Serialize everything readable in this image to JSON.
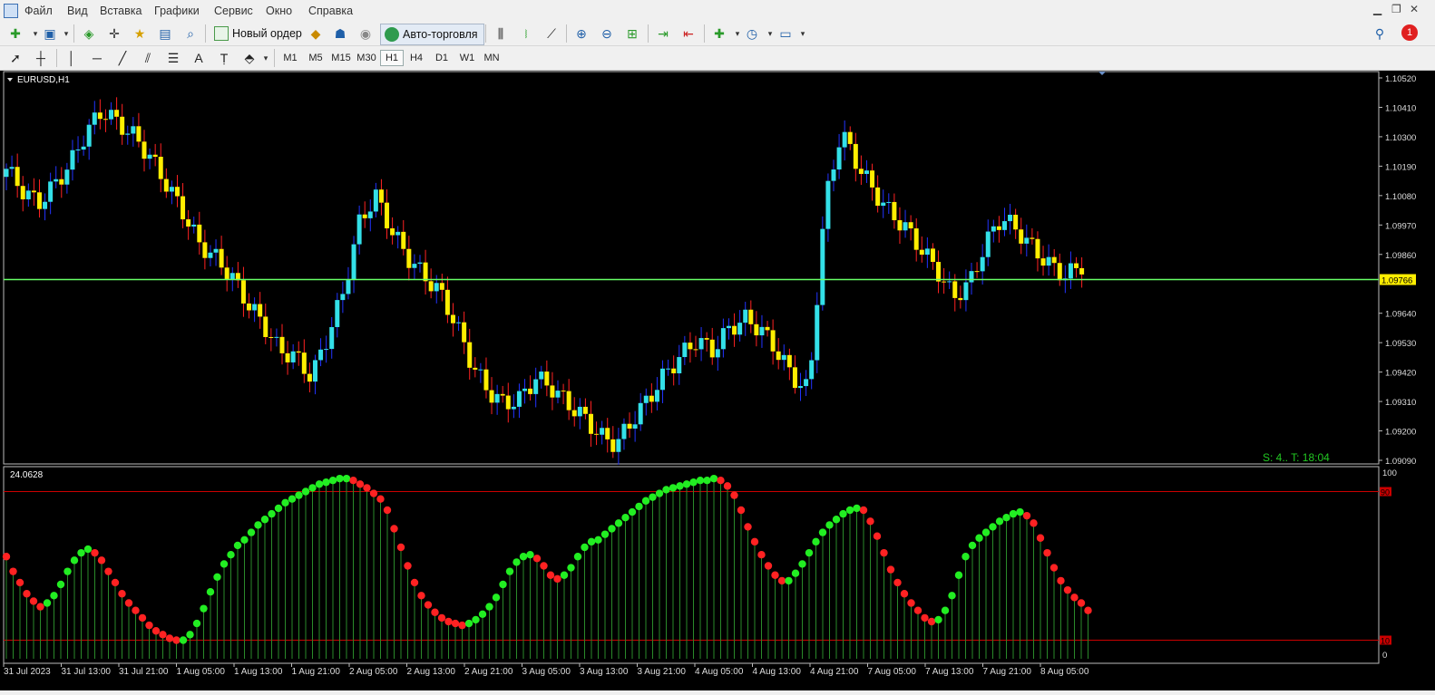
{
  "menu": [
    "Файл",
    "Вид",
    "Вставка",
    "Графики",
    "Сервис",
    "Окно",
    "Справка"
  ],
  "toolbar": {
    "new_order": "Новый ордер",
    "auto_trading": "Авто-торговля",
    "notification_count": "1"
  },
  "timeframes": [
    "M1",
    "M5",
    "M15",
    "M30",
    "H1",
    "H4",
    "D1",
    "W1",
    "MN"
  ],
  "active_timeframe": "H1",
  "chart": {
    "symbol": "EURUSD,H1",
    "price_ticks": [
      "1.10520",
      "1.10410",
      "1.10300",
      "1.10190",
      "1.10080",
      "1.09970",
      "1.09860",
      "1.09640",
      "1.09530",
      "1.09420",
      "1.09310",
      "1.09200",
      "1.09090"
    ],
    "current_price": "1.09766",
    "status": "S: 4.. T: 18:04",
    "time_ticks": [
      "31 Jul 2023",
      "31 Jul 13:00",
      "31 Jul 21:00",
      "1 Aug 05:00",
      "1 Aug 13:00",
      "1 Aug 21:00",
      "2 Aug 05:00",
      "2 Aug 13:00",
      "2 Aug 21:00",
      "3 Aug 05:00",
      "3 Aug 13:00",
      "3 Aug 21:00",
      "4 Aug 05:00",
      "4 Aug 13:00",
      "4 Aug 21:00",
      "7 Aug 05:00",
      "7 Aug 13:00",
      "7 Aug 21:00",
      "8 Aug 05:00"
    ],
    "colors": {
      "bull": "#33e0e8",
      "bear": "#ffee00",
      "wick_up": "#2233ff",
      "wick_down": "#ff2222",
      "price_line": "#66ff66"
    }
  },
  "indicator": {
    "value": "24.0628",
    "scale_top": "100",
    "scale_bottom": "0",
    "level_high": "90",
    "level_low": "10",
    "colors": {
      "rising": "#22ee22",
      "falling": "#ff2222",
      "stem": "#2a8a2a",
      "level": "#cc0000"
    }
  },
  "chart_data": {
    "type": "line",
    "price_range": [
      1.0909,
      1.1052
    ],
    "current_price": 1.09766,
    "indicator_range": [
      0,
      100
    ],
    "indicator_levels": [
      90,
      10
    ],
    "indicator_values": [
      55,
      47,
      41,
      35,
      31,
      28,
      30,
      34,
      40,
      47,
      53,
      57,
      59,
      57,
      53,
      47,
      41,
      35,
      30,
      26,
      22,
      18,
      15,
      13,
      11,
      10,
      10,
      13,
      19,
      27,
      36,
      44,
      51,
      56,
      61,
      64,
      68,
      72,
      75,
      78,
      81,
      84,
      86,
      88,
      90,
      92,
      94,
      95,
      96,
      97,
      97,
      96,
      94,
      92,
      89,
      86,
      80,
      70,
      60,
      50,
      41,
      34,
      29,
      25,
      22,
      20,
      19,
      18,
      19,
      21,
      24,
      28,
      33,
      40,
      47,
      52,
      55,
      56,
      54,
      50,
      45,
      43,
      45,
      49,
      55,
      60,
      63,
      64,
      67,
      70,
      73,
      76,
      79,
      82,
      85,
      87,
      89,
      91,
      92,
      93,
      94,
      95,
      96,
      96,
      97,
      96,
      93,
      88,
      80,
      71,
      63,
      56,
      50,
      45,
      42,
      42,
      46,
      51,
      57,
      63,
      68,
      72,
      75,
      78,
      80,
      81,
      80,
      74,
      66,
      57,
      48,
      41,
      35,
      30,
      26,
      22,
      20,
      21,
      26,
      34,
      45,
      55,
      61,
      65,
      68,
      71,
      74,
      76,
      78,
      79,
      77,
      73,
      65,
      57,
      49,
      42,
      37,
      33,
      30,
      26
    ]
  }
}
